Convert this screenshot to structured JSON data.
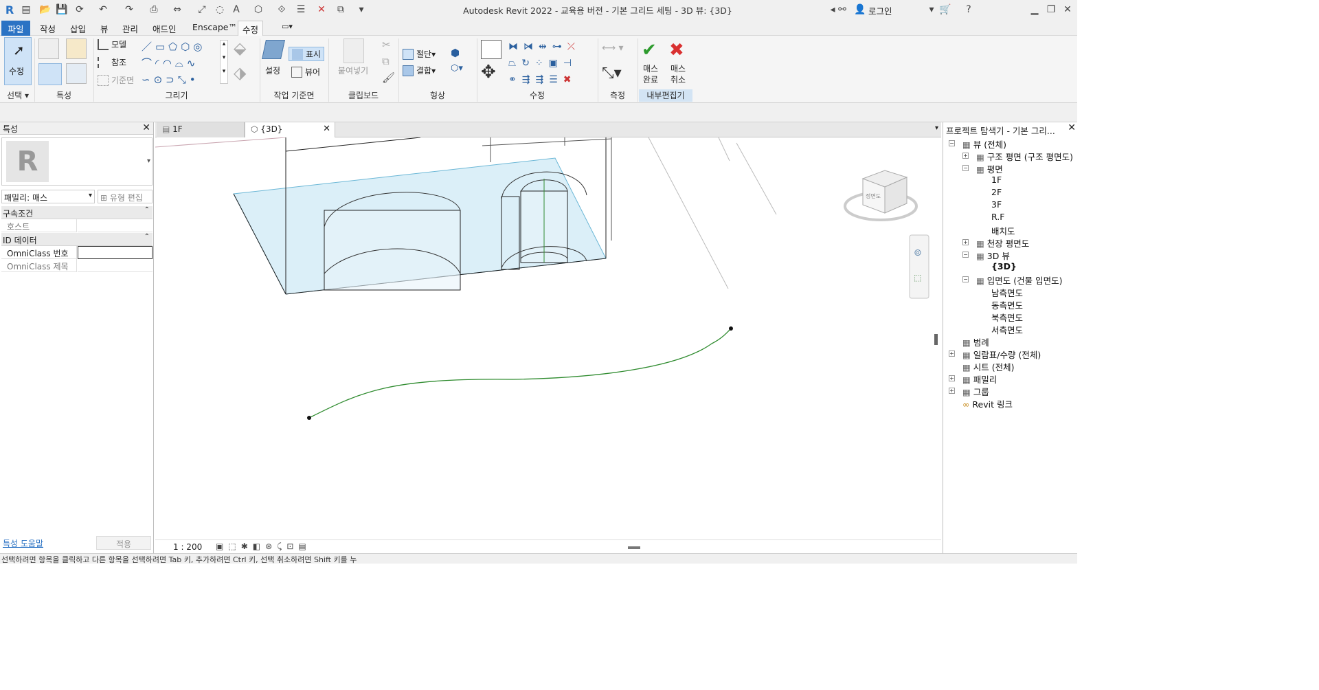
{
  "app": {
    "title": "Autodesk Revit 2022 - 교육용 버전 - 기본 그리드 세팅 - 3D 뷰: {3D}",
    "login": "로그인"
  },
  "ribbon_tabs": [
    "파일",
    "작성",
    "삽입",
    "뷰",
    "관리",
    "애드인",
    "Enscape™",
    "수정"
  ],
  "ribbon": {
    "modify_label": "수정",
    "select_panel": "선택",
    "props_panel": "특성",
    "draw_panel": "그리기",
    "model_label": "모델",
    "ref_label": "참조",
    "plane_label": "기준면",
    "workplane_panel": "작업 기준면",
    "set_label": "설정",
    "show_label": "표시",
    "viewer_label": "뷰어",
    "clipboard_panel": "클립보드",
    "paste_label": "붙여넣기",
    "geometry_panel": "형상",
    "cut_label": "절단",
    "join_label": "결합",
    "modify_panel": "수정",
    "measure_panel": "측정",
    "finish_mass_1": "매스",
    "finish_mass_2": "완료",
    "cancel_mass_1": "매스",
    "cancel_mass_2": "취소",
    "inplace_panel": "내부편집기"
  },
  "properties": {
    "title": "특성",
    "family": "패밀리: 매스",
    "edit_type": "유형 편집",
    "constraints": "구속조건",
    "host": "호스트",
    "id_data": "ID 데이터",
    "omniclass_number": "OmniClass 번호",
    "omniclass_title": "OmniClass 제목",
    "help": "특성 도움말",
    "apply": "적용"
  },
  "view_tabs": [
    "1F",
    "{3D}"
  ],
  "viewcube_face": "정면도",
  "view_scale": "1 : 200",
  "browser": {
    "title": "프로젝트 탐색기 - 기본 그리...",
    "items": [
      {
        "label": "뷰 (전체)",
        "level": 0,
        "toggle": "-"
      },
      {
        "label": "구조 평면 (구조 평면도)",
        "level": 1,
        "toggle": "+"
      },
      {
        "label": "평면",
        "level": 1,
        "toggle": "-"
      },
      {
        "label": "1F",
        "level": 2,
        "toggle": ""
      },
      {
        "label": "2F",
        "level": 2,
        "toggle": ""
      },
      {
        "label": "3F",
        "level": 2,
        "toggle": ""
      },
      {
        "label": "R.F",
        "level": 2,
        "toggle": ""
      },
      {
        "label": "배치도",
        "level": 2,
        "toggle": ""
      },
      {
        "label": "천장 평면도",
        "level": 1,
        "toggle": "+"
      },
      {
        "label": "3D 뷰",
        "level": 1,
        "toggle": "-"
      },
      {
        "label": "{3D}",
        "level": 2,
        "toggle": "",
        "bold": true
      },
      {
        "label": "입면도 (건물 입면도)",
        "level": 1,
        "toggle": "-"
      },
      {
        "label": "남측면도",
        "level": 2,
        "toggle": ""
      },
      {
        "label": "동측면도",
        "level": 2,
        "toggle": ""
      },
      {
        "label": "북측면도",
        "level": 2,
        "toggle": ""
      },
      {
        "label": "서측면도",
        "level": 2,
        "toggle": ""
      },
      {
        "label": "범례",
        "level": 0,
        "toggle": ""
      },
      {
        "label": "일람표/수량 (전체)",
        "level": 0,
        "toggle": "+"
      },
      {
        "label": "시트 (전체)",
        "level": 0,
        "toggle": ""
      },
      {
        "label": "패밀리",
        "level": 0,
        "toggle": "+"
      },
      {
        "label": "그룹",
        "level": 0,
        "toggle": "+"
      },
      {
        "label": "Revit 링크",
        "level": 0,
        "toggle": ""
      }
    ]
  },
  "status": "선택하려면 항목을 클릭하고 다른 항목을 선택하려면 Tab 키, 추가하려면 Ctrl 키, 선택 취소하려면 Shift 키를 누",
  "colors": {
    "accent": "#2b73c4",
    "plane": "#d6eef8",
    "curve": "#2e8b2e",
    "check": "#2e9b2e",
    "cancel": "#d93030"
  }
}
